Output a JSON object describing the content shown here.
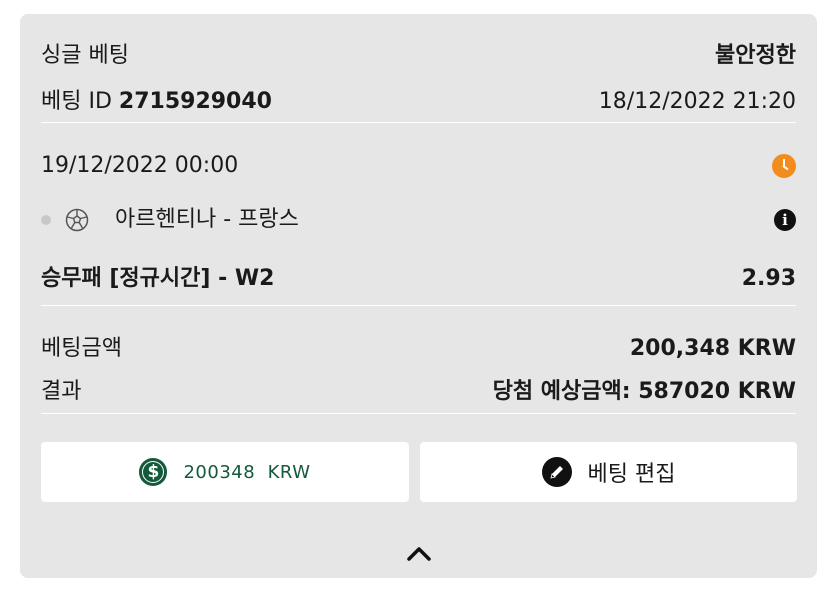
{
  "header": {
    "bet_type": "싱글 베팅",
    "status": "불안정한",
    "bet_id_label": "베팅 ID",
    "bet_id": "2715929040",
    "placed_at": "18/12/2022 21:20"
  },
  "event": {
    "date": "19/12/2022 00:00",
    "match": "아르헨티나 - 프랑스",
    "market": "승무패 [정규시간] - W2",
    "odds": "2.93",
    "sport_icon": "soccer-ball-icon",
    "status_icon": "clock-icon"
  },
  "summary": {
    "stake_label": "베팅금액",
    "stake_value": "200,348 KRW",
    "result_label": "결과",
    "result_value": "당첨 예상금액: 587020 KRW"
  },
  "actions": {
    "cashout_label": "200348  KRW",
    "edit_label": "베팅 편집"
  },
  "colors": {
    "card_bg": "#e6e6e6",
    "clock": "#f28c1c",
    "cashout_green": "#135a3a"
  }
}
